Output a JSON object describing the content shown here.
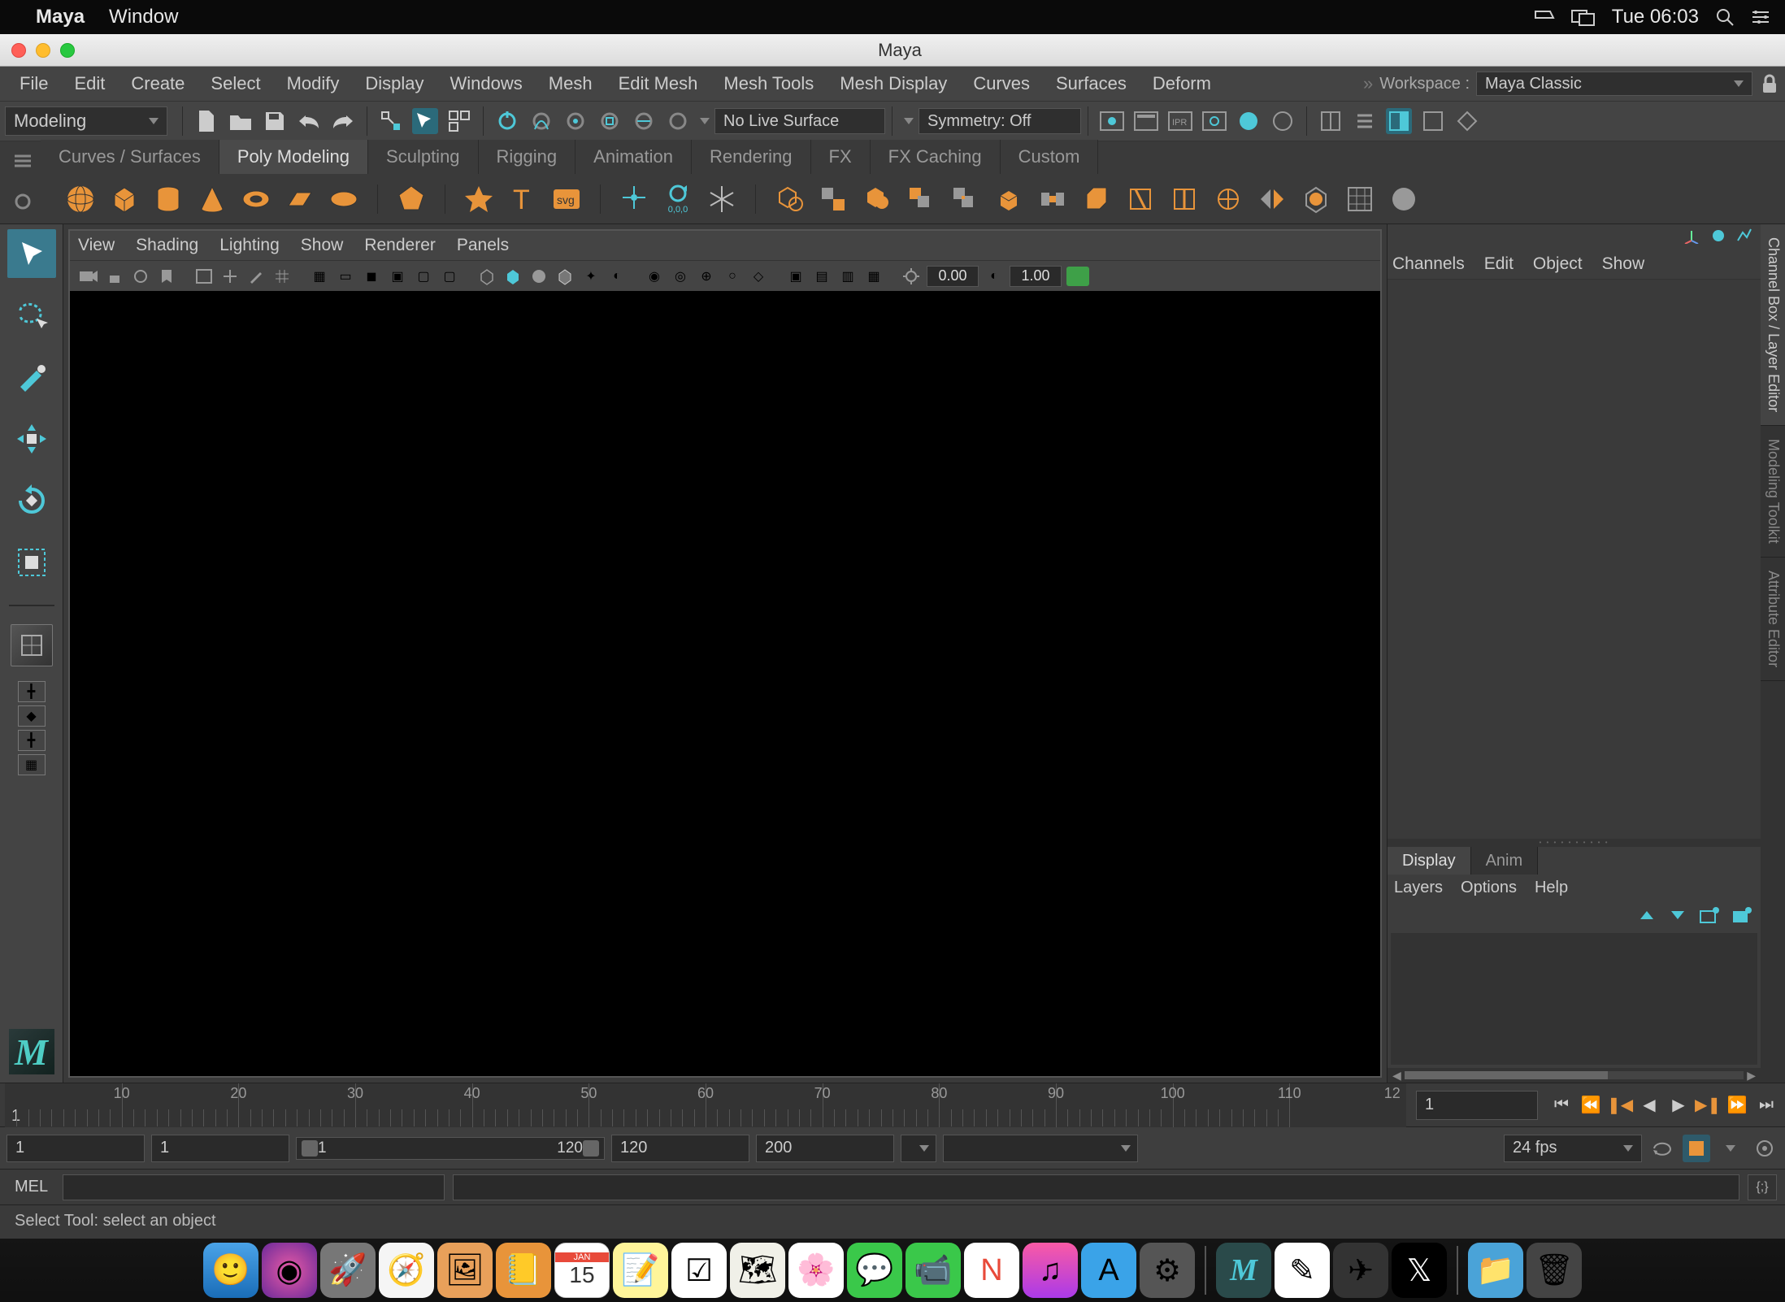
{
  "macbar": {
    "app": "Maya",
    "menu": [
      "Window"
    ],
    "clock": "Tue 06:03"
  },
  "window": {
    "title": "Maya"
  },
  "menus": [
    "File",
    "Edit",
    "Create",
    "Select",
    "Modify",
    "Display",
    "Windows",
    "Mesh",
    "Edit Mesh",
    "Mesh Tools",
    "Mesh Display",
    "Curves",
    "Surfaces",
    "Deform"
  ],
  "workspace_label": "Workspace :",
  "workspace_value": "Maya Classic",
  "mode": "Modeling",
  "live_surface": "No Live Surface",
  "symmetry": "Symmetry: Off",
  "shelf_tabs": [
    "Curves / Surfaces",
    "Poly Modeling",
    "Sculpting",
    "Rigging",
    "Animation",
    "Rendering",
    "FX",
    "FX Caching",
    "Custom"
  ],
  "shelf_active": 1,
  "viewport_menus": [
    "View",
    "Shading",
    "Lighting",
    "Show",
    "Renderer",
    "Panels"
  ],
  "vp_exposure": "0.00",
  "vp_gamma": "1.00",
  "channel_menus": [
    "Channels",
    "Edit",
    "Object",
    "Show"
  ],
  "layer_tabs": [
    "Display",
    "Anim"
  ],
  "layer_menus": [
    "Layers",
    "Options",
    "Help"
  ],
  "side_tabs": [
    "Channel Box / Layer Editor",
    "Modeling Toolkit",
    "Attribute Editor"
  ],
  "timeline": {
    "start_display": 1,
    "marks": [
      10,
      20,
      30,
      40,
      50,
      60,
      70,
      80,
      90,
      100,
      110
    ],
    "end_cut": "12",
    "current_field": "1"
  },
  "range": {
    "start": "1",
    "in": "1",
    "slider_in": "1",
    "slider_out": "120",
    "out": "120",
    "end": "200",
    "fps": "24 fps"
  },
  "cmd_label": "MEL",
  "help_line": "Select Tool: select an object",
  "svg_label": "svg",
  "pivot_label": "0,0,0"
}
